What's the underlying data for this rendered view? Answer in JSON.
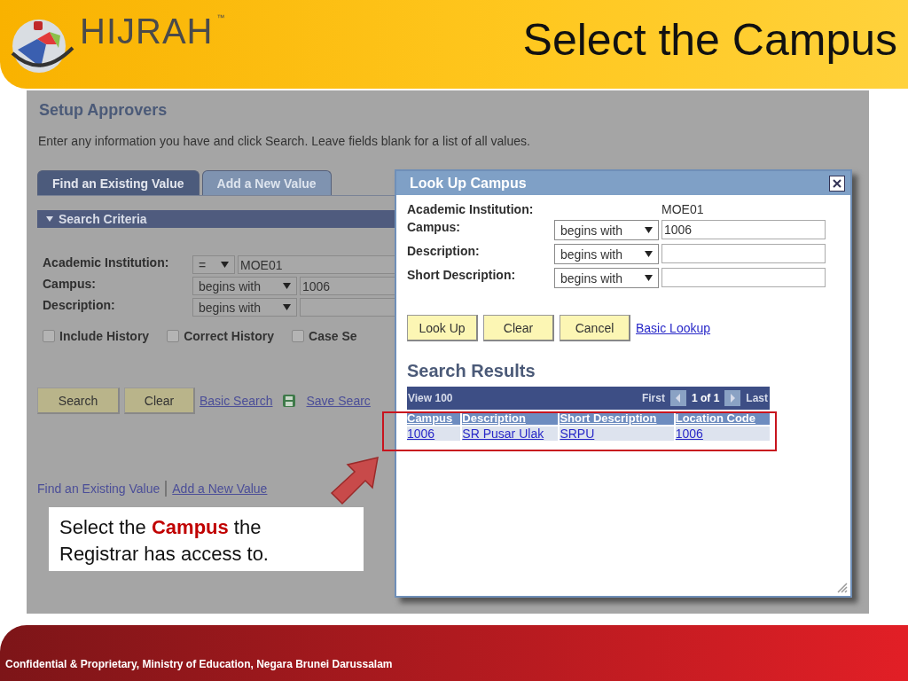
{
  "slide": {
    "title": "Select the Campus",
    "logo": {
      "name": "HIJRAH",
      "mark": "™"
    }
  },
  "page": {
    "heading": "Setup Approvers",
    "instructions": "Enter any information you have and click Search. Leave fields blank for a list of all values.",
    "tabs": [
      {
        "label": "Find an Existing Value",
        "selected": true
      },
      {
        "label": "Add a New Value",
        "selected": false
      }
    ],
    "section": {
      "label": "Search Criteria",
      "expanded": true
    },
    "fields": [
      {
        "label": "Academic Institution:",
        "operator": "=",
        "value": "MOE01"
      },
      {
        "label": "Campus:",
        "operator": "begins with",
        "value": "1006"
      },
      {
        "label": "Description:",
        "operator": "begins with"
      }
    ],
    "checkboxes": [
      {
        "label": "Include History",
        "checked": false
      },
      {
        "label": "Correct History",
        "checked": false
      },
      {
        "label": "Case Se",
        "checked": false
      }
    ],
    "buttons": [
      "Search",
      "Clear"
    ],
    "links": [
      "Basic Search",
      "Save Searc"
    ],
    "bottom_links": [
      {
        "label": "Find an Existing Value",
        "selected": true
      },
      {
        "label": "Add a New Value",
        "selected": false
      }
    ]
  },
  "lookup": {
    "title": "Look Up Campus",
    "institution": {
      "label": "Academic Institution:",
      "value": "MOE01"
    },
    "fields": [
      {
        "label": "Campus:",
        "operator": "begins with",
        "value": "1006"
      },
      {
        "label": "Description:",
        "operator": "begins with"
      },
      {
        "label": "Short Description:",
        "operator": "begins with"
      }
    ],
    "buttons": [
      "Look Up",
      "Clear",
      "Cancel"
    ],
    "link": "Basic Lookup",
    "results": {
      "title": "Search Results",
      "view": "View 100",
      "first": "First",
      "page": "1 of 1",
      "last": "Last",
      "columns": [
        "Campus",
        "Description",
        "Short Description",
        "Location Code"
      ],
      "rows": [
        [
          "1006",
          "SR Pusar Ulak",
          "SRPU",
          "1006"
        ]
      ]
    }
  },
  "callout": "Select the **Campus** the Registrar has access to.",
  "footer": "Confidential & Proprietary, Ministry of Education, Negara Brunei Darussalam"
}
